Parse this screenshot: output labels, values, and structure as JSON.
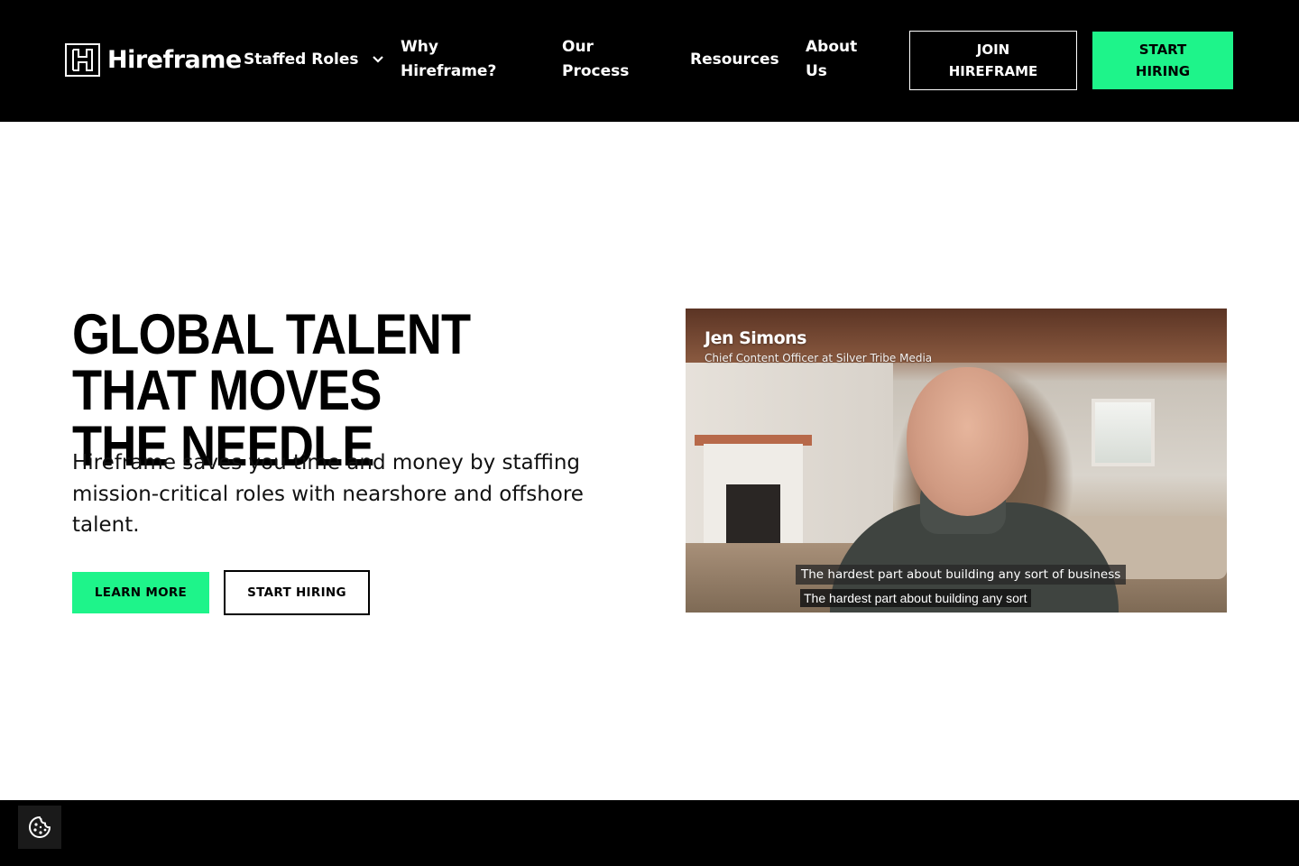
{
  "brand": {
    "name": "Hireframe",
    "accent_color": "#1ef48a"
  },
  "nav": {
    "items": [
      {
        "label": "Staffed Roles",
        "icon": "chevron-down-icon"
      },
      {
        "label": "Why Hireframe?"
      },
      {
        "label": "Our Process"
      },
      {
        "label": "Resources"
      },
      {
        "label": "About Us"
      }
    ],
    "join_label": "JOIN HIREFRAME",
    "start_label": "START HIRING"
  },
  "hero": {
    "title": "GLOBAL TALENT THAT MOVES THE NEEDLE",
    "subtitle": "Hireframe saves you time and money by staffing mission-critical roles with nearshore and offshore talent.",
    "learn_more_label": "LEARN MORE",
    "start_hiring_label": "START HIRING"
  },
  "video": {
    "speaker_name": "Jen Simons",
    "speaker_role": "Chief Content Officer at Silver Tribe Media",
    "caption_burned": "The hardest part about building any sort of business",
    "caption_live": "The hardest part about building any sort"
  },
  "footer": {
    "cookie_icon": "cookie-icon"
  }
}
